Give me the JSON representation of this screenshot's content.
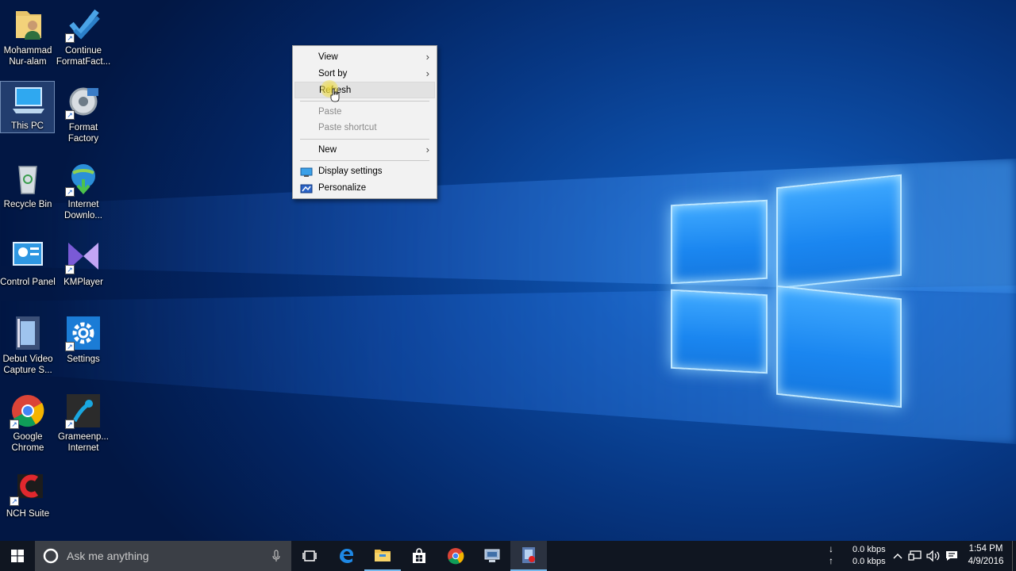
{
  "desktop_icons": [
    {
      "label": "Mohammad Nur-alam"
    },
    {
      "label": "Continue FormatFact..."
    },
    {
      "label": "This PC"
    },
    {
      "label": "Format Factory"
    },
    {
      "label": "Recycle Bin"
    },
    {
      "label": "Internet Downlo..."
    },
    {
      "label": "Control Panel"
    },
    {
      "label": "KMPlayer"
    },
    {
      "label": "Debut Video Capture S..."
    },
    {
      "label": "Settings"
    },
    {
      "label": "Google Chrome"
    },
    {
      "label": "Grameenp... Internet"
    },
    {
      "label": "NCH Suite"
    }
  ],
  "context_menu": {
    "view": "View",
    "sort_by": "Sort by",
    "refresh": "Refresh",
    "paste": "Paste",
    "paste_shortcut": "Paste shortcut",
    "new": "New",
    "display_settings": "Display settings",
    "personalize": "Personalize"
  },
  "taskbar": {
    "search_placeholder": "Ask me anything",
    "download_speed": "0.0 kbps",
    "upload_speed": "0.0 kbps",
    "time": "1:54 PM",
    "date": "4/9/2016"
  },
  "colors": {
    "taskbar_bg": "#101621",
    "search_bg": "#3b3f46",
    "menu_bg": "#f2f2f2",
    "accent": "#1a86f0"
  }
}
